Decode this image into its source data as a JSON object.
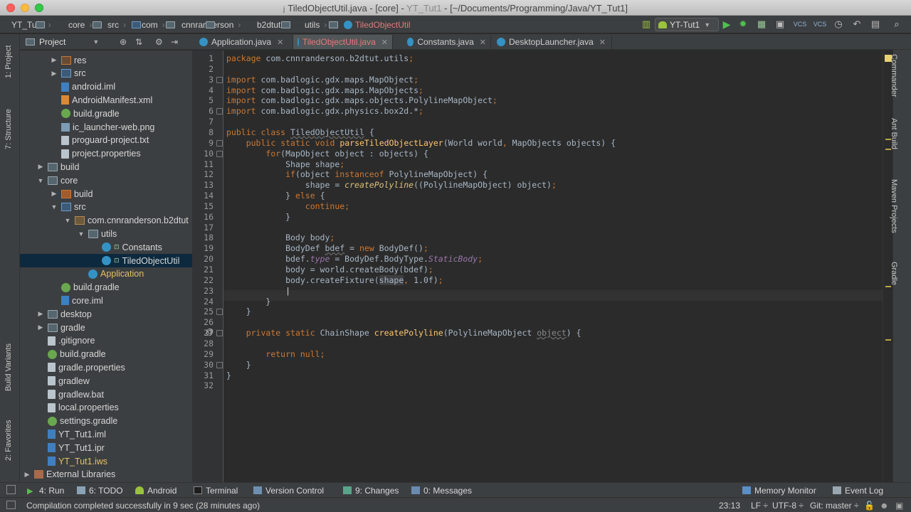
{
  "window": {
    "title": "TiledObjectUtil.java - [core] - ",
    "title_project": "YT_Tut1",
    "title_path": " - [~/Documents/Programming/Java/YT_Tut1]"
  },
  "breadcrumbs": [
    "YT_Tut1",
    "core",
    "src",
    "com",
    "cnnranderson",
    "b2dtut",
    "utils",
    "TiledObjectUtil"
  ],
  "run_config": "YT-Tut1",
  "project_panel": {
    "view": "Project",
    "tree": [
      {
        "label": "res",
        "indent": 2,
        "arrow": "right",
        "icon": "res"
      },
      {
        "label": "src",
        "indent": 2,
        "arrow": "right",
        "icon": "src"
      },
      {
        "label": "android.iml",
        "indent": 2,
        "icon": "iml"
      },
      {
        "label": "AndroidManifest.xml",
        "indent": 2,
        "icon": "xml"
      },
      {
        "label": "build.gradle",
        "indent": 2,
        "icon": "gradle"
      },
      {
        "label": "ic_launcher-web.png",
        "indent": 2,
        "icon": "img"
      },
      {
        "label": "proguard-project.txt",
        "indent": 2,
        "icon": "file"
      },
      {
        "label": "project.properties",
        "indent": 2,
        "icon": "file"
      },
      {
        "label": "build",
        "indent": 1,
        "arrow": "right",
        "icon": "folder"
      },
      {
        "label": "core",
        "indent": 1,
        "arrow": "down",
        "icon": "folder"
      },
      {
        "label": "build",
        "indent": 2,
        "arrow": "right",
        "icon": "build"
      },
      {
        "label": "src",
        "indent": 2,
        "arrow": "down",
        "icon": "src"
      },
      {
        "label": "com.cnnranderson.b2dtut",
        "indent": 3,
        "arrow": "down",
        "icon": "pkg"
      },
      {
        "label": "utils",
        "indent": 4,
        "arrow": "down",
        "icon": "folder"
      },
      {
        "label": "Constants",
        "indent": 5,
        "icon": "class"
      },
      {
        "label": "TiledObjectUtil",
        "indent": 5,
        "icon": "class",
        "selected": true
      },
      {
        "label": "Application",
        "indent": 4,
        "icon": "class",
        "orange": true
      },
      {
        "label": "build.gradle",
        "indent": 2,
        "icon": "gradle"
      },
      {
        "label": "core.iml",
        "indent": 2,
        "icon": "iml"
      },
      {
        "label": "desktop",
        "indent": 1,
        "arrow": "right",
        "icon": "folder"
      },
      {
        "label": "gradle",
        "indent": 1,
        "arrow": "right",
        "icon": "folder"
      },
      {
        "label": ".gitignore",
        "indent": 1,
        "icon": "file"
      },
      {
        "label": "build.gradle",
        "indent": 1,
        "icon": "gradle"
      },
      {
        "label": "gradle.properties",
        "indent": 1,
        "icon": "file"
      },
      {
        "label": "gradlew",
        "indent": 1,
        "icon": "file"
      },
      {
        "label": "gradlew.bat",
        "indent": 1,
        "icon": "file"
      },
      {
        "label": "local.properties",
        "indent": 1,
        "icon": "file"
      },
      {
        "label": "settings.gradle",
        "indent": 1,
        "icon": "gradle"
      },
      {
        "label": "YT_Tut1.iml",
        "indent": 1,
        "icon": "iml"
      },
      {
        "label": "YT_Tut1.ipr",
        "indent": 1,
        "icon": "iml"
      },
      {
        "label": "YT_Tut1.iws",
        "indent": 1,
        "icon": "iml",
        "orange": true
      },
      {
        "label": "External Libraries",
        "indent": 0,
        "arrow": "right",
        "icon": "lib"
      }
    ]
  },
  "tabs": [
    {
      "label": "Application.java",
      "active": false
    },
    {
      "label": "TiledObjectUtil.java",
      "active": true
    },
    {
      "label": "Constants.java",
      "active": false
    },
    {
      "label": "DesktopLauncher.java",
      "active": false
    }
  ],
  "left_tool_windows": [
    "1: Project",
    "7: Structure",
    "Build Variants",
    "2: Favorites"
  ],
  "right_tool_windows": [
    "Commander",
    "Ant Build",
    "Maven Projects",
    "Gradle"
  ],
  "code": {
    "line_numbers": [
      "1",
      "2",
      "3",
      "4",
      "5",
      "6",
      "7",
      "8",
      "9",
      "10",
      "11",
      "12",
      "13",
      "14",
      "15",
      "16",
      "17",
      "18",
      "19",
      "20",
      "21",
      "22",
      "23",
      "24",
      "25",
      "26",
      "27",
      "28",
      "29",
      "30",
      "31",
      "32"
    ],
    "lines": [
      "package com.cnnranderson.b2dtut.utils;",
      "",
      "import com.badlogic.gdx.maps.MapObject;",
      "import com.badlogic.gdx.maps.MapObjects;",
      "import com.badlogic.gdx.maps.objects.PolylineMapObject;",
      "import com.badlogic.gdx.physics.box2d.*;",
      "",
      "public class TiledObjectUtil {",
      "    public static void parseTiledObjectLayer(World world, MapObjects objects) {",
      "        for(MapObject object : objects) {",
      "            Shape shape;",
      "            if(object instanceof PolylineMapObject) {",
      "                shape = createPolyline((PolylineMapObject) object);",
      "            } else {",
      "                continue;",
      "            }",
      "",
      "            Body body;",
      "            BodyDef bdef = new BodyDef();",
      "            bdef.type = BodyDef.BodyType.StaticBody;",
      "            body = world.createBody(bdef);",
      "            body.createFixture(shape, 1.0f);",
      "            |",
      "        }",
      "    }",
      "",
      "    private static ChainShape createPolyline(PolylineMapObject object) {",
      "",
      "        return null;",
      "    }",
      "}",
      ""
    ]
  },
  "bottom_tools": [
    "4: Run",
    "6: TODO",
    "Android",
    "Terminal",
    "Version Control",
    "9: Changes",
    "0: Messages",
    "Memory Monitor",
    "Event Log"
  ],
  "status": {
    "message": "Compilation completed successfully in 9 sec (28 minutes ago)",
    "position": "23:13",
    "line_sep": "LF ÷",
    "encoding": "UTF-8 ÷",
    "vcs": "Git: master ÷"
  },
  "colors": {
    "background": "#2b2b2b",
    "keyword": "#cc7832",
    "method": "#ffc66d",
    "number": "#6897bb",
    "text": "#a9b7c6",
    "active_tab_text": "#e57a7a"
  }
}
